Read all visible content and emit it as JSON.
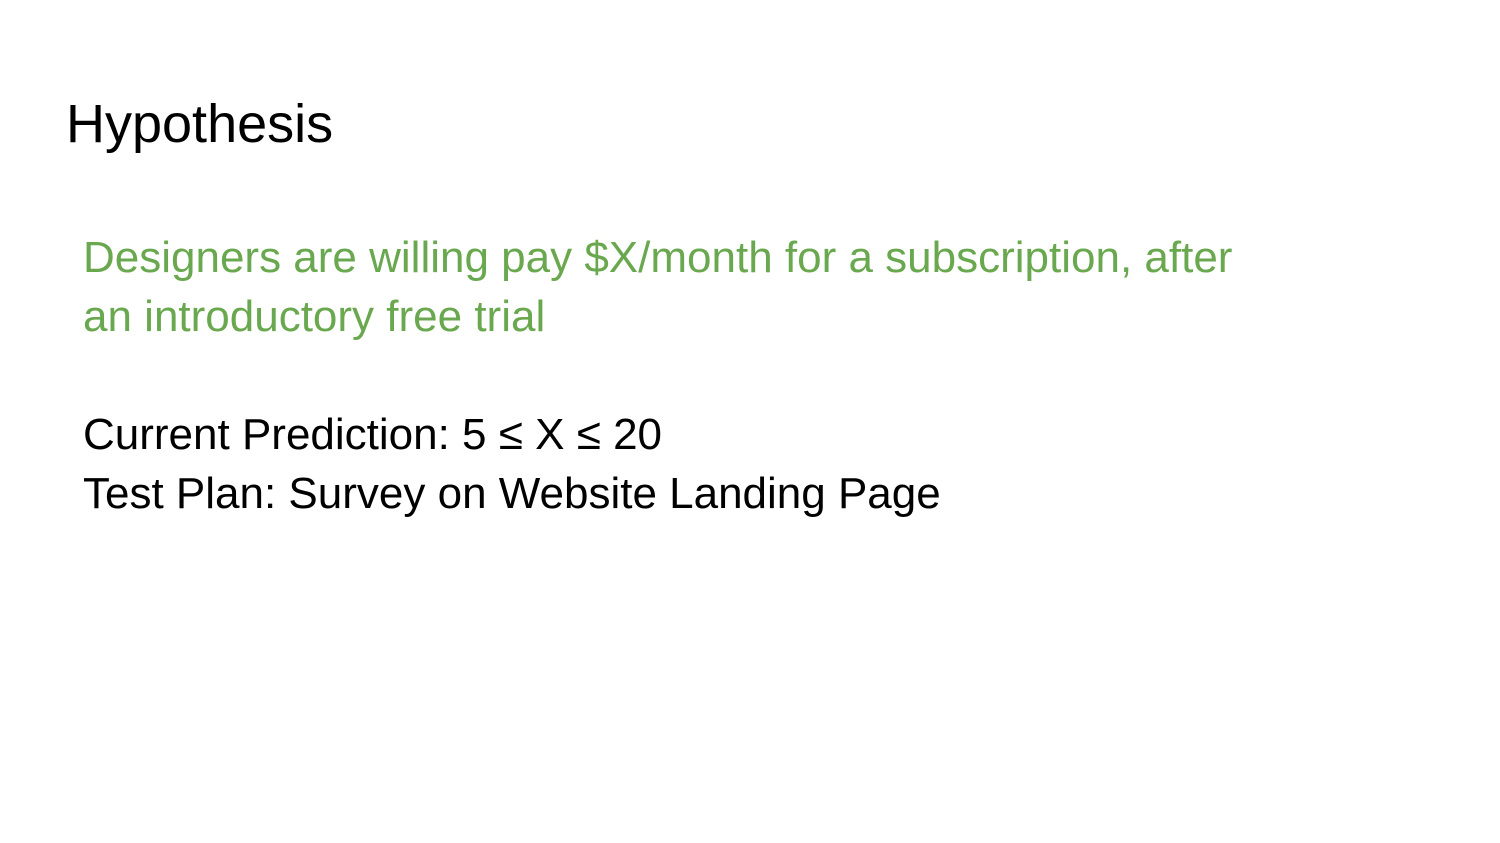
{
  "slide": {
    "title": "Hypothesis",
    "hypothesis_line_1": "Designers are willing pay $X/month for a subscription, after",
    "hypothesis_line_2": "an introductory free trial",
    "prediction": "Current Prediction: 5 ≤ X ≤ 20",
    "test_plan": "Test Plan: Survey on Website Landing Page",
    "colors": {
      "hypothesis_text": "#6aa84f",
      "body_text": "#000000",
      "background": "#ffffff"
    }
  }
}
